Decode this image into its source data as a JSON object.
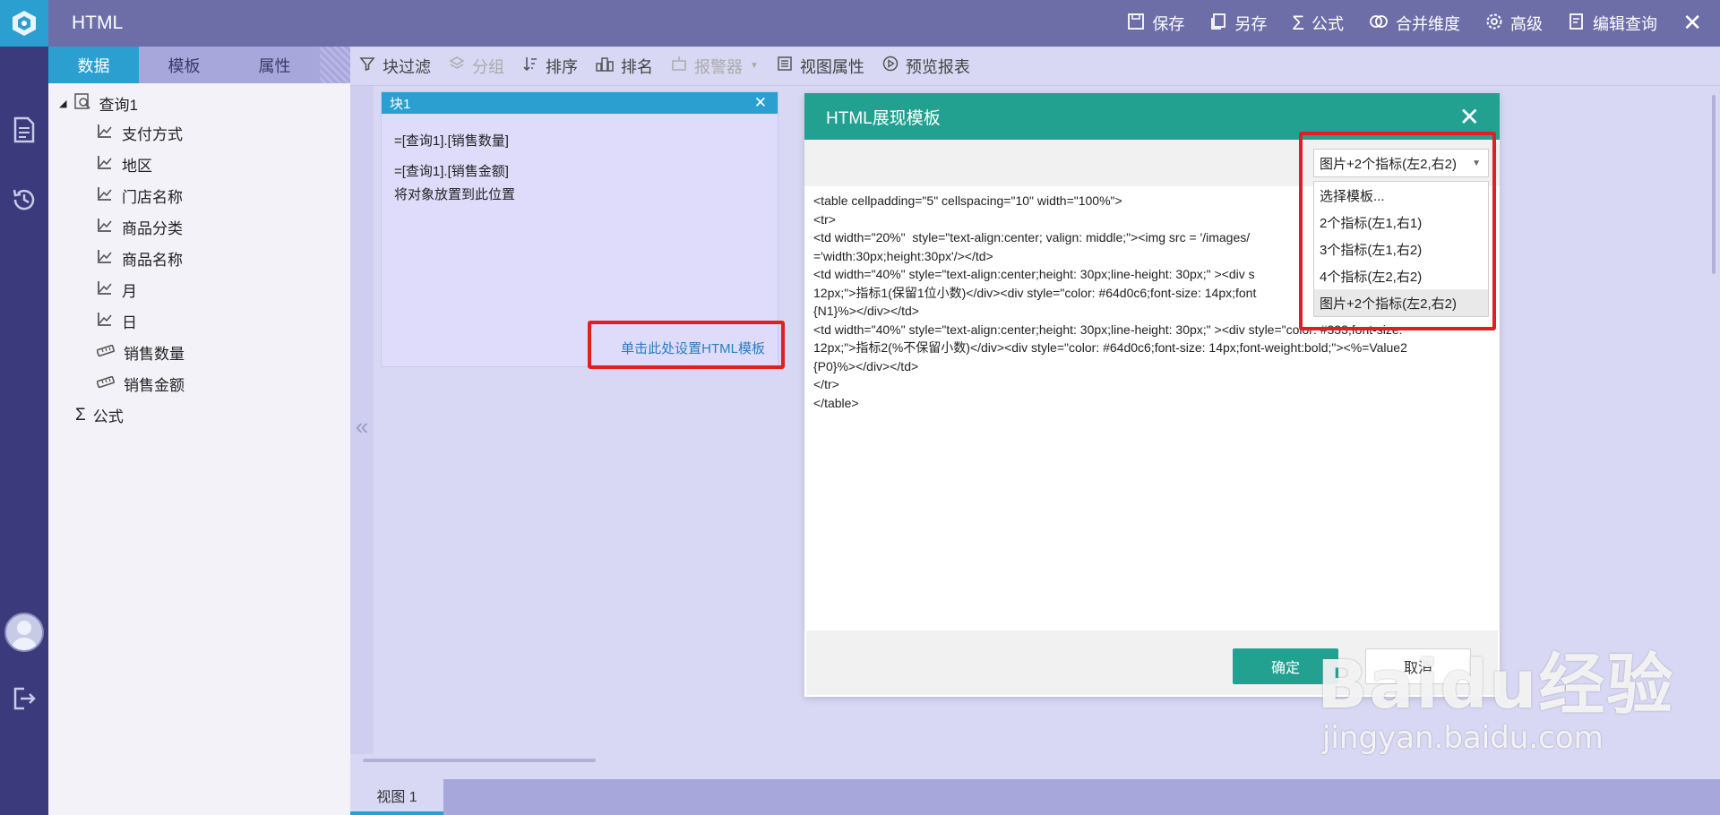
{
  "app": {
    "title": "HTML"
  },
  "topbar": {
    "actions": [
      {
        "label": "保存",
        "icon": "save-icon"
      },
      {
        "label": "另存",
        "icon": "save-as-icon"
      },
      {
        "label": "公式",
        "icon": "sigma-icon"
      },
      {
        "label": "合并维度",
        "icon": "merge-icon"
      },
      {
        "label": "高级",
        "icon": "gear-icon"
      },
      {
        "label": "编辑查询",
        "icon": "edit-query-icon"
      }
    ],
    "close": "✕"
  },
  "leftpanel": {
    "tabs": [
      "数据",
      "模板",
      "属性"
    ],
    "active_tab": "数据",
    "tree_root": "查询1",
    "tree_items": [
      {
        "label": "支付方式",
        "type": "dimension"
      },
      {
        "label": "地区",
        "type": "dimension"
      },
      {
        "label": "门店名称",
        "type": "dimension"
      },
      {
        "label": "商品分类",
        "type": "dimension"
      },
      {
        "label": "商品名称",
        "type": "dimension"
      },
      {
        "label": "月",
        "type": "dimension"
      },
      {
        "label": "日",
        "type": "dimension"
      },
      {
        "label": "销售数量",
        "type": "measure"
      },
      {
        "label": "销售金额",
        "type": "measure"
      }
    ],
    "formula": "公式"
  },
  "toolbar": {
    "items": [
      {
        "label": "块过滤",
        "icon": "filter-icon",
        "enabled": true
      },
      {
        "label": "分组",
        "icon": "group-icon",
        "enabled": false
      },
      {
        "label": "排序",
        "icon": "sort-icon",
        "enabled": true
      },
      {
        "label": "排名",
        "icon": "rank-icon",
        "enabled": true
      },
      {
        "label": "报警器",
        "icon": "alarm-icon",
        "enabled": false
      },
      {
        "label": "视图属性",
        "icon": "properties-icon",
        "enabled": true
      },
      {
        "label": "预览报表",
        "icon": "preview-icon",
        "enabled": true
      }
    ]
  },
  "block": {
    "title": "块1",
    "close": "✕",
    "line1": "=[查询1].[销售数量]",
    "line2": "=[查询1].[销售金额]",
    "line3": "将对象放置到此位置",
    "link": "单击此处设置HTML模板"
  },
  "dialog": {
    "title": "HTML展现模板",
    "close": "✕",
    "select_value": "图片+2个指标(左2,右2)",
    "options": [
      "选择模板...",
      "2个指标(左1,右1)",
      "3个指标(左1,右2)",
      "4个指标(左2,右2)",
      "图片+2个指标(左2,右2)"
    ],
    "selected_index": 4,
    "code_lines": [
      "<table cellpadding=\"5\" cellspacing=\"10\" width=\"100%\">",
      "<tr>",
      "<td width=\"20%\"  style=\"text-align:center; valign: middle;\"><img src = '/images/",
      "='width:30px;height:30px'/></td>",
      "<td width=\"40%\" style=\"text-align:center;height: 30px;line-height: 30px;\" ><div s",
      "12px;\">指标1(保留1位小数)</div><div style=\"color: #64d0c6;font-size: 14px;font",
      "{N1}%></div></td>",
      "<td width=\"40%\" style=\"text-align:center;height: 30px;line-height: 30px;\" ><div style=\"color: #333;font-size:",
      "12px;\">指标2(%不保留小数)</div><div style=\"color: #64d0c6;font-size: 14px;font-weight:bold;\"><%=Value2",
      "{P0}%></div></td>",
      "</tr>",
      "</table>"
    ],
    "ok": "确定",
    "cancel": "取消"
  },
  "bottombar": {
    "view_tab": "视图 1"
  },
  "watermark": {
    "main": "Baidu经验",
    "sub": "jingyan.baidu.com"
  },
  "colors": {
    "primary": "#2a9fd0",
    "dialog_accent": "#22a191",
    "highlight": "#e02020",
    "topbar": "#6d6ea8",
    "rail": "#3b3a7c"
  }
}
